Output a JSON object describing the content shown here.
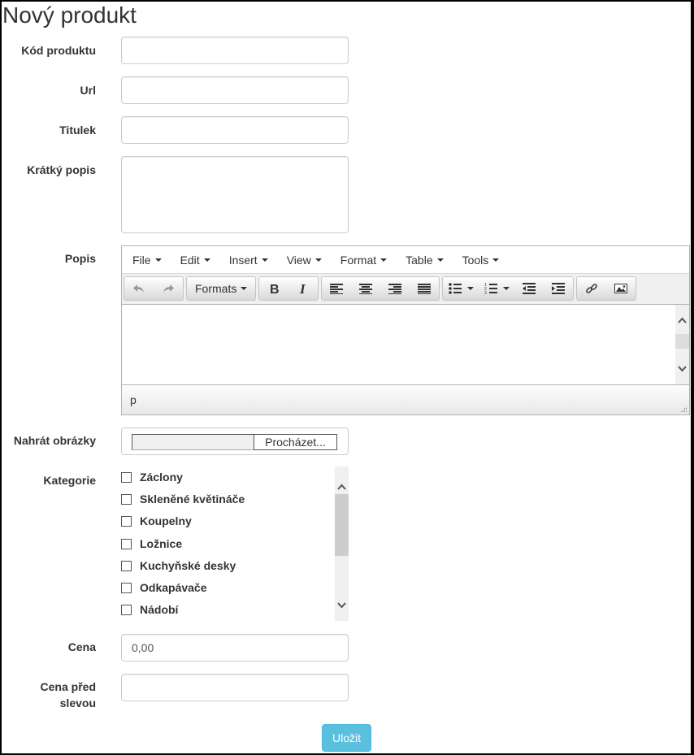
{
  "page": {
    "title": "Nový produkt"
  },
  "fields": {
    "code": {
      "label": "Kód produktu",
      "value": ""
    },
    "url": {
      "label": "Url",
      "value": ""
    },
    "title": {
      "label": "Titulek",
      "value": ""
    },
    "short_desc": {
      "label": "Krátký popis",
      "value": ""
    },
    "description": {
      "label": "Popis"
    },
    "upload": {
      "label": "Nahrát obrázky",
      "browse_label": "Procházet..."
    },
    "categories": {
      "label": "Kategorie"
    },
    "price": {
      "label": "Cena",
      "value": "0,00"
    },
    "price_before": {
      "label_line1": "Cena před",
      "label_line2": "slevou",
      "value": ""
    }
  },
  "editor": {
    "menus": [
      "File",
      "Edit",
      "Insert",
      "View",
      "Format",
      "Table",
      "Tools"
    ],
    "formats_label": "Formats",
    "toolbar_icons": [
      "undo-icon",
      "redo-icon",
      "bold-icon",
      "italic-icon",
      "align-left-icon",
      "align-center-icon",
      "align-right-icon",
      "align-justify-icon",
      "bullet-list-icon",
      "numbered-list-icon",
      "outdent-icon",
      "indent-icon",
      "link-icon",
      "image-icon"
    ],
    "status_path": "p"
  },
  "categories": [
    {
      "label": "Záclony",
      "checked": false
    },
    {
      "label": "Skleněné květináče",
      "checked": false
    },
    {
      "label": "Koupelny",
      "checked": false
    },
    {
      "label": "Ložnice",
      "checked": false
    },
    {
      "label": "Kuchyňské desky",
      "checked": false
    },
    {
      "label": "Odkapávače",
      "checked": false
    },
    {
      "label": "Nádobí",
      "checked": false
    }
  ],
  "submit": {
    "label": "Uložit"
  },
  "colors": {
    "submit_bg": "#5bc0de"
  }
}
